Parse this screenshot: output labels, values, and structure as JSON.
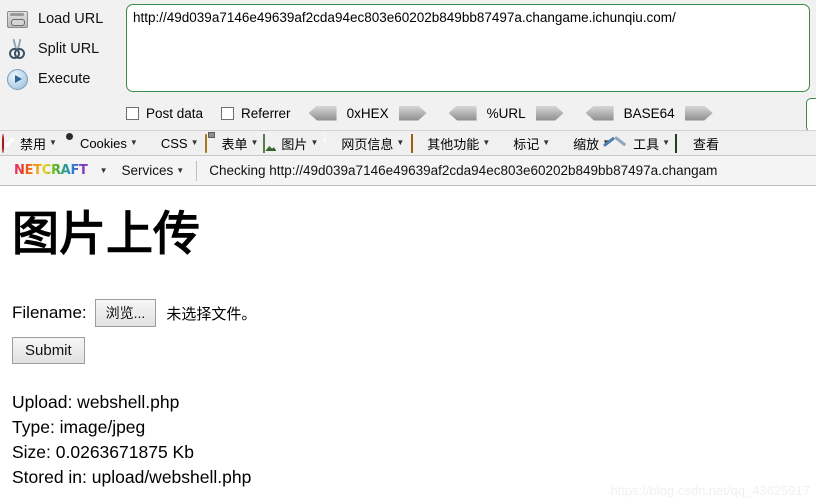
{
  "hackbar": {
    "actions": [
      {
        "label": "Load URL",
        "accel": "a",
        "icon": "drive-icon",
        "name": "load-url"
      },
      {
        "label": "Split URL",
        "accel": "S",
        "icon": "scissors-icon",
        "name": "split-url"
      },
      {
        "label": "Execute",
        "accel": "x",
        "icon": "play-icon",
        "name": "execute"
      }
    ],
    "url_value": "http://49d039a7146e49639af2cda94ec803e60202b849bb87497a.changame.ichunqiu.com/",
    "url_placeholder": "",
    "checkboxes": [
      {
        "label": "Post data",
        "checked": false
      },
      {
        "label": "Referrer",
        "checked": false
      }
    ],
    "encoders": [
      {
        "label": "0xHEX"
      },
      {
        "label": "%URL"
      },
      {
        "label": "BASE64"
      }
    ]
  },
  "devtoolbar": {
    "items": [
      {
        "label": "禁用",
        "icon": "ban-icon",
        "caret": true
      },
      {
        "label": "Cookies",
        "icon": "cookie-icon",
        "caret": true
      },
      {
        "label": "CSS",
        "icon": "css-pencil-icon",
        "caret": true
      },
      {
        "label": "表单",
        "icon": "clipboard-icon",
        "caret": true
      },
      {
        "label": "图片",
        "icon": "image-icon",
        "caret": true
      },
      {
        "label": "网页信息",
        "icon": "info-icon",
        "caret": true
      },
      {
        "label": "其他功能",
        "icon": "book-icon",
        "caret": true
      },
      {
        "label": "标记",
        "icon": "pencil-icon",
        "caret": true
      },
      {
        "label": "缩放",
        "icon": "orange-pencil-icon",
        "caret": true
      },
      {
        "label": "工具",
        "icon": "tools-icon",
        "caret": true
      },
      {
        "label": "查看",
        "icon": "screen-icon",
        "caret": true
      }
    ]
  },
  "netcraft": {
    "logo_text": "NETCRAFT",
    "services_label": "Services",
    "status_text": "Checking http://49d039a7146e49639af2cda94ec803e60202b849bb87497a.changam"
  },
  "page": {
    "title": "图片上传",
    "filename_label": "Filename:",
    "browse_button": "浏览...",
    "no_file_text": "未选择文件。",
    "submit_button": "Submit",
    "result": {
      "upload": "Upload: webshell.php",
      "type": "Type: image/jpeg",
      "size": "Size: 0.0263671875 Kb",
      "stored": "Stored in: upload/webshell.php"
    }
  },
  "watermark": "https://blog.csdn.net/qq_43625917",
  "colors": {
    "textarea_border": "#3a8a47",
    "toolbar_bg": "#f1f1f1",
    "accent_red": "#e02b1d"
  }
}
